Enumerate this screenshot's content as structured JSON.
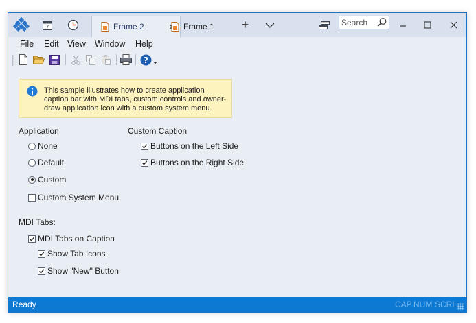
{
  "caption": {
    "tabs": [
      {
        "label": "Frame 2",
        "active": true
      },
      {
        "label": "Frame 1",
        "active": false
      }
    ],
    "search_placeholder": "Search"
  },
  "menu": [
    "File",
    "Edit",
    "View",
    "Window",
    "Help"
  ],
  "info_text": "This sample illustrates how to create application caption bar with MDI tabs, custom controls and owner-draw application icon with a custom system menu.",
  "application": {
    "label": "Application",
    "options": [
      {
        "label": "None",
        "checked": false
      },
      {
        "label": "Default",
        "checked": false
      },
      {
        "label": "Custom",
        "checked": true
      }
    ],
    "custom_system_menu": {
      "label": "Custom System Menu",
      "checked": false
    }
  },
  "custom_caption": {
    "label": "Custom Caption",
    "options": [
      {
        "label": "Buttons on the Left Side",
        "checked": true
      },
      {
        "label": "Buttons on the Right Side",
        "checked": true
      }
    ]
  },
  "mdi": {
    "label": "MDI Tabs:",
    "options": [
      {
        "label": "MDI Tabs on Caption",
        "checked": true
      },
      {
        "label": "Show Tab Icons",
        "checked": true
      },
      {
        "label": "Show \"New\" Button",
        "checked": true
      }
    ]
  },
  "status": {
    "text": "Ready",
    "indicators": [
      "CAP",
      "NUM",
      "SCRL"
    ]
  },
  "colors": {
    "accent": "#0e79d3",
    "caption_bg": "#d9e1ef",
    "client_bg": "#e9edf4",
    "info_bg": "#fdf3bf"
  }
}
